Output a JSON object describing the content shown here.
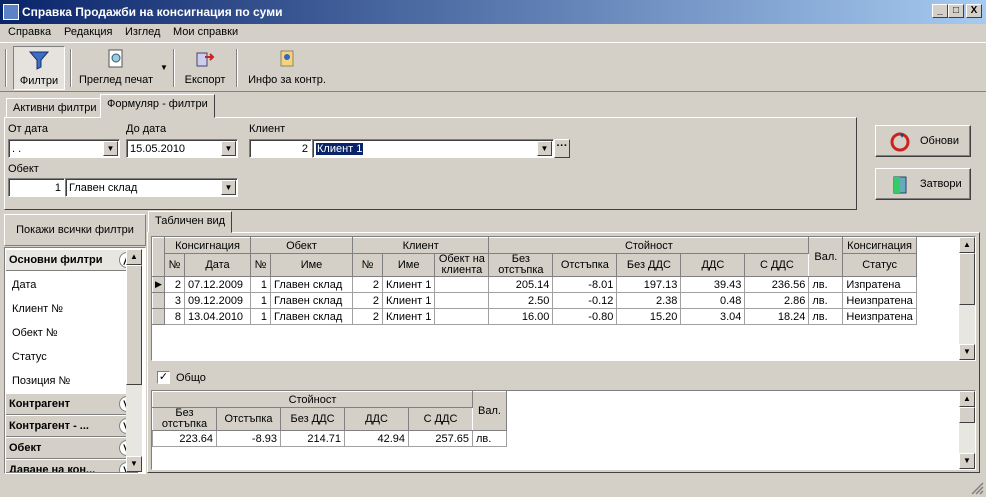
{
  "window": {
    "title": "Справка Продажби на консигнация по суми",
    "min": "_",
    "max": "□",
    "close": "X"
  },
  "menu": [
    "Справка",
    "Редакция",
    "Изглед",
    "Мои справки"
  ],
  "toolbar": {
    "filters": "Филтри",
    "print_preview": "Преглед печат",
    "export": "Експорт",
    "info": "Инфо за контр."
  },
  "tabs": {
    "active_filters": "Активни филтри",
    "form_filters": "Формуляр - филтри"
  },
  "filters": {
    "from_date_label": "От дата",
    "from_date_value": ".  .",
    "to_date_label": "До дата",
    "to_date_value": "15.05.2010",
    "client_label": "Клиент",
    "client_no": "2",
    "client_name": "Клиент 1",
    "object_label": "Обект",
    "object_no": "1",
    "object_name": "Главен склад"
  },
  "buttons": {
    "refresh": "Обнови",
    "close": "Затвори"
  },
  "sidebar": {
    "show_all": "Покажи всички филтри",
    "groups": [
      {
        "label": "Основни филтри",
        "expanded": true,
        "items": [
          "Дата",
          "Клиент №",
          "Обект №",
          "Статус",
          "Позиция №"
        ]
      },
      {
        "label": "Контрагент"
      },
      {
        "label": "Контрагент - ..."
      },
      {
        "label": "Обект"
      },
      {
        "label": "Даване на кон..."
      }
    ]
  },
  "table_tab": "Табличен вид",
  "main_table": {
    "groups": {
      "consignment": "Консигнация",
      "object": "Обект",
      "client": "Клиент",
      "value": "Стойност",
      "currency": "Вал.",
      "consignment2": "Консигнация"
    },
    "columns": {
      "no": "№",
      "date": "Дата",
      "obj_no": "№",
      "obj_name": "Име",
      "cl_no": "№",
      "cl_name": "Име",
      "cl_obj": "Обект на клиента",
      "no_discount": "Без отстъпка",
      "discount": "Отстъпка",
      "no_vat": "Без ДДС",
      "vat": "ДДС",
      "with_vat": "С ДДС",
      "status": "Статус"
    },
    "rows": [
      {
        "no": "2",
        "date": "07.12.2009",
        "obj_no": "1",
        "obj_name": "Главен склад",
        "cl_no": "2",
        "cl_name": "Клиент 1",
        "cl_obj": "",
        "no_discount": "205.14",
        "discount": "-8.01",
        "no_vat": "197.13",
        "vat": "39.43",
        "with_vat": "236.56",
        "cur": "лв.",
        "status": "Изпратена"
      },
      {
        "no": "3",
        "date": "09.12.2009",
        "obj_no": "1",
        "obj_name": "Главен склад",
        "cl_no": "2",
        "cl_name": "Клиент 1",
        "cl_obj": "",
        "no_discount": "2.50",
        "discount": "-0.12",
        "no_vat": "2.38",
        "vat": "0.48",
        "with_vat": "2.86",
        "cur": "лв.",
        "status": "Неизпратена"
      },
      {
        "no": "8",
        "date": "13.04.2010",
        "obj_no": "1",
        "obj_name": "Главен склад",
        "cl_no": "2",
        "cl_name": "Клиент 1",
        "cl_obj": "",
        "no_discount": "16.00",
        "discount": "-0.80",
        "no_vat": "15.20",
        "vat": "3.04",
        "with_vat": "18.24",
        "cur": "лв.",
        "status": "Неизпратена"
      }
    ]
  },
  "total": {
    "checkbox_label": "Общо",
    "checked": true,
    "group": "Стойност",
    "currency_header": "Вал.",
    "columns": {
      "no_discount": "Без отстъпка",
      "discount": "Отстъпка",
      "no_vat": "Без ДДС",
      "vat": "ДДС",
      "with_vat": "С ДДС"
    },
    "row": {
      "no_discount": "223.64",
      "discount": "-8.93",
      "no_vat": "214.71",
      "vat": "42.94",
      "with_vat": "257.65",
      "cur": "лв."
    }
  }
}
